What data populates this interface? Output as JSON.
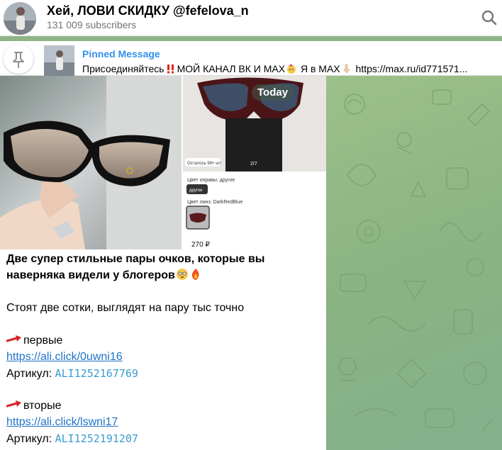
{
  "header": {
    "title": "Хей, ЛОВИ СКИДКУ @fefelova_n",
    "subscribers": "131 009 subscribers"
  },
  "pinned": {
    "label": "Pinned Message",
    "text_part1": "Присоединяйтесь",
    "text_part2": "МОЙ КАНАЛ ВК И МАХ",
    "text_part3": " Я в МАХ",
    "text_part4": " https://max.ru/id771571..."
  },
  "date_badge": "Today",
  "product_card": {
    "stock": "Осталось 99+ шт",
    "counter": "2/7",
    "frame_color_label": "Цвет оправы: другое",
    "frame_color_value": "другое",
    "lens_color_label": "Цвет линз: DarkRedBlue",
    "price": "270 ₽"
  },
  "message": {
    "headline_1": "Две супер стильные пары очков, которые вы",
    "headline_2": "наверняка видели у блогеров",
    "line_2": "Стоят две сотки, выглядят на пару тыс точно",
    "first_label": "первые",
    "first_link": "https://ali.click/0uwni16",
    "first_article_label": "Артикул: ",
    "first_article_code": "ALI1252167769",
    "second_label": "вторые",
    "second_link": "https://ali.click/lswni17",
    "second_article_label": "Артикул: ",
    "second_article_code": "ALI1252191207"
  },
  "icons": {
    "search": "search-icon",
    "pin": "pin-icon",
    "arrow": "red-arrow-icon"
  },
  "colors": {
    "accent": "#3390ec",
    "link": "#1f73c7",
    "code": "#3a9bd1",
    "chat_bg": "#8fb586"
  }
}
